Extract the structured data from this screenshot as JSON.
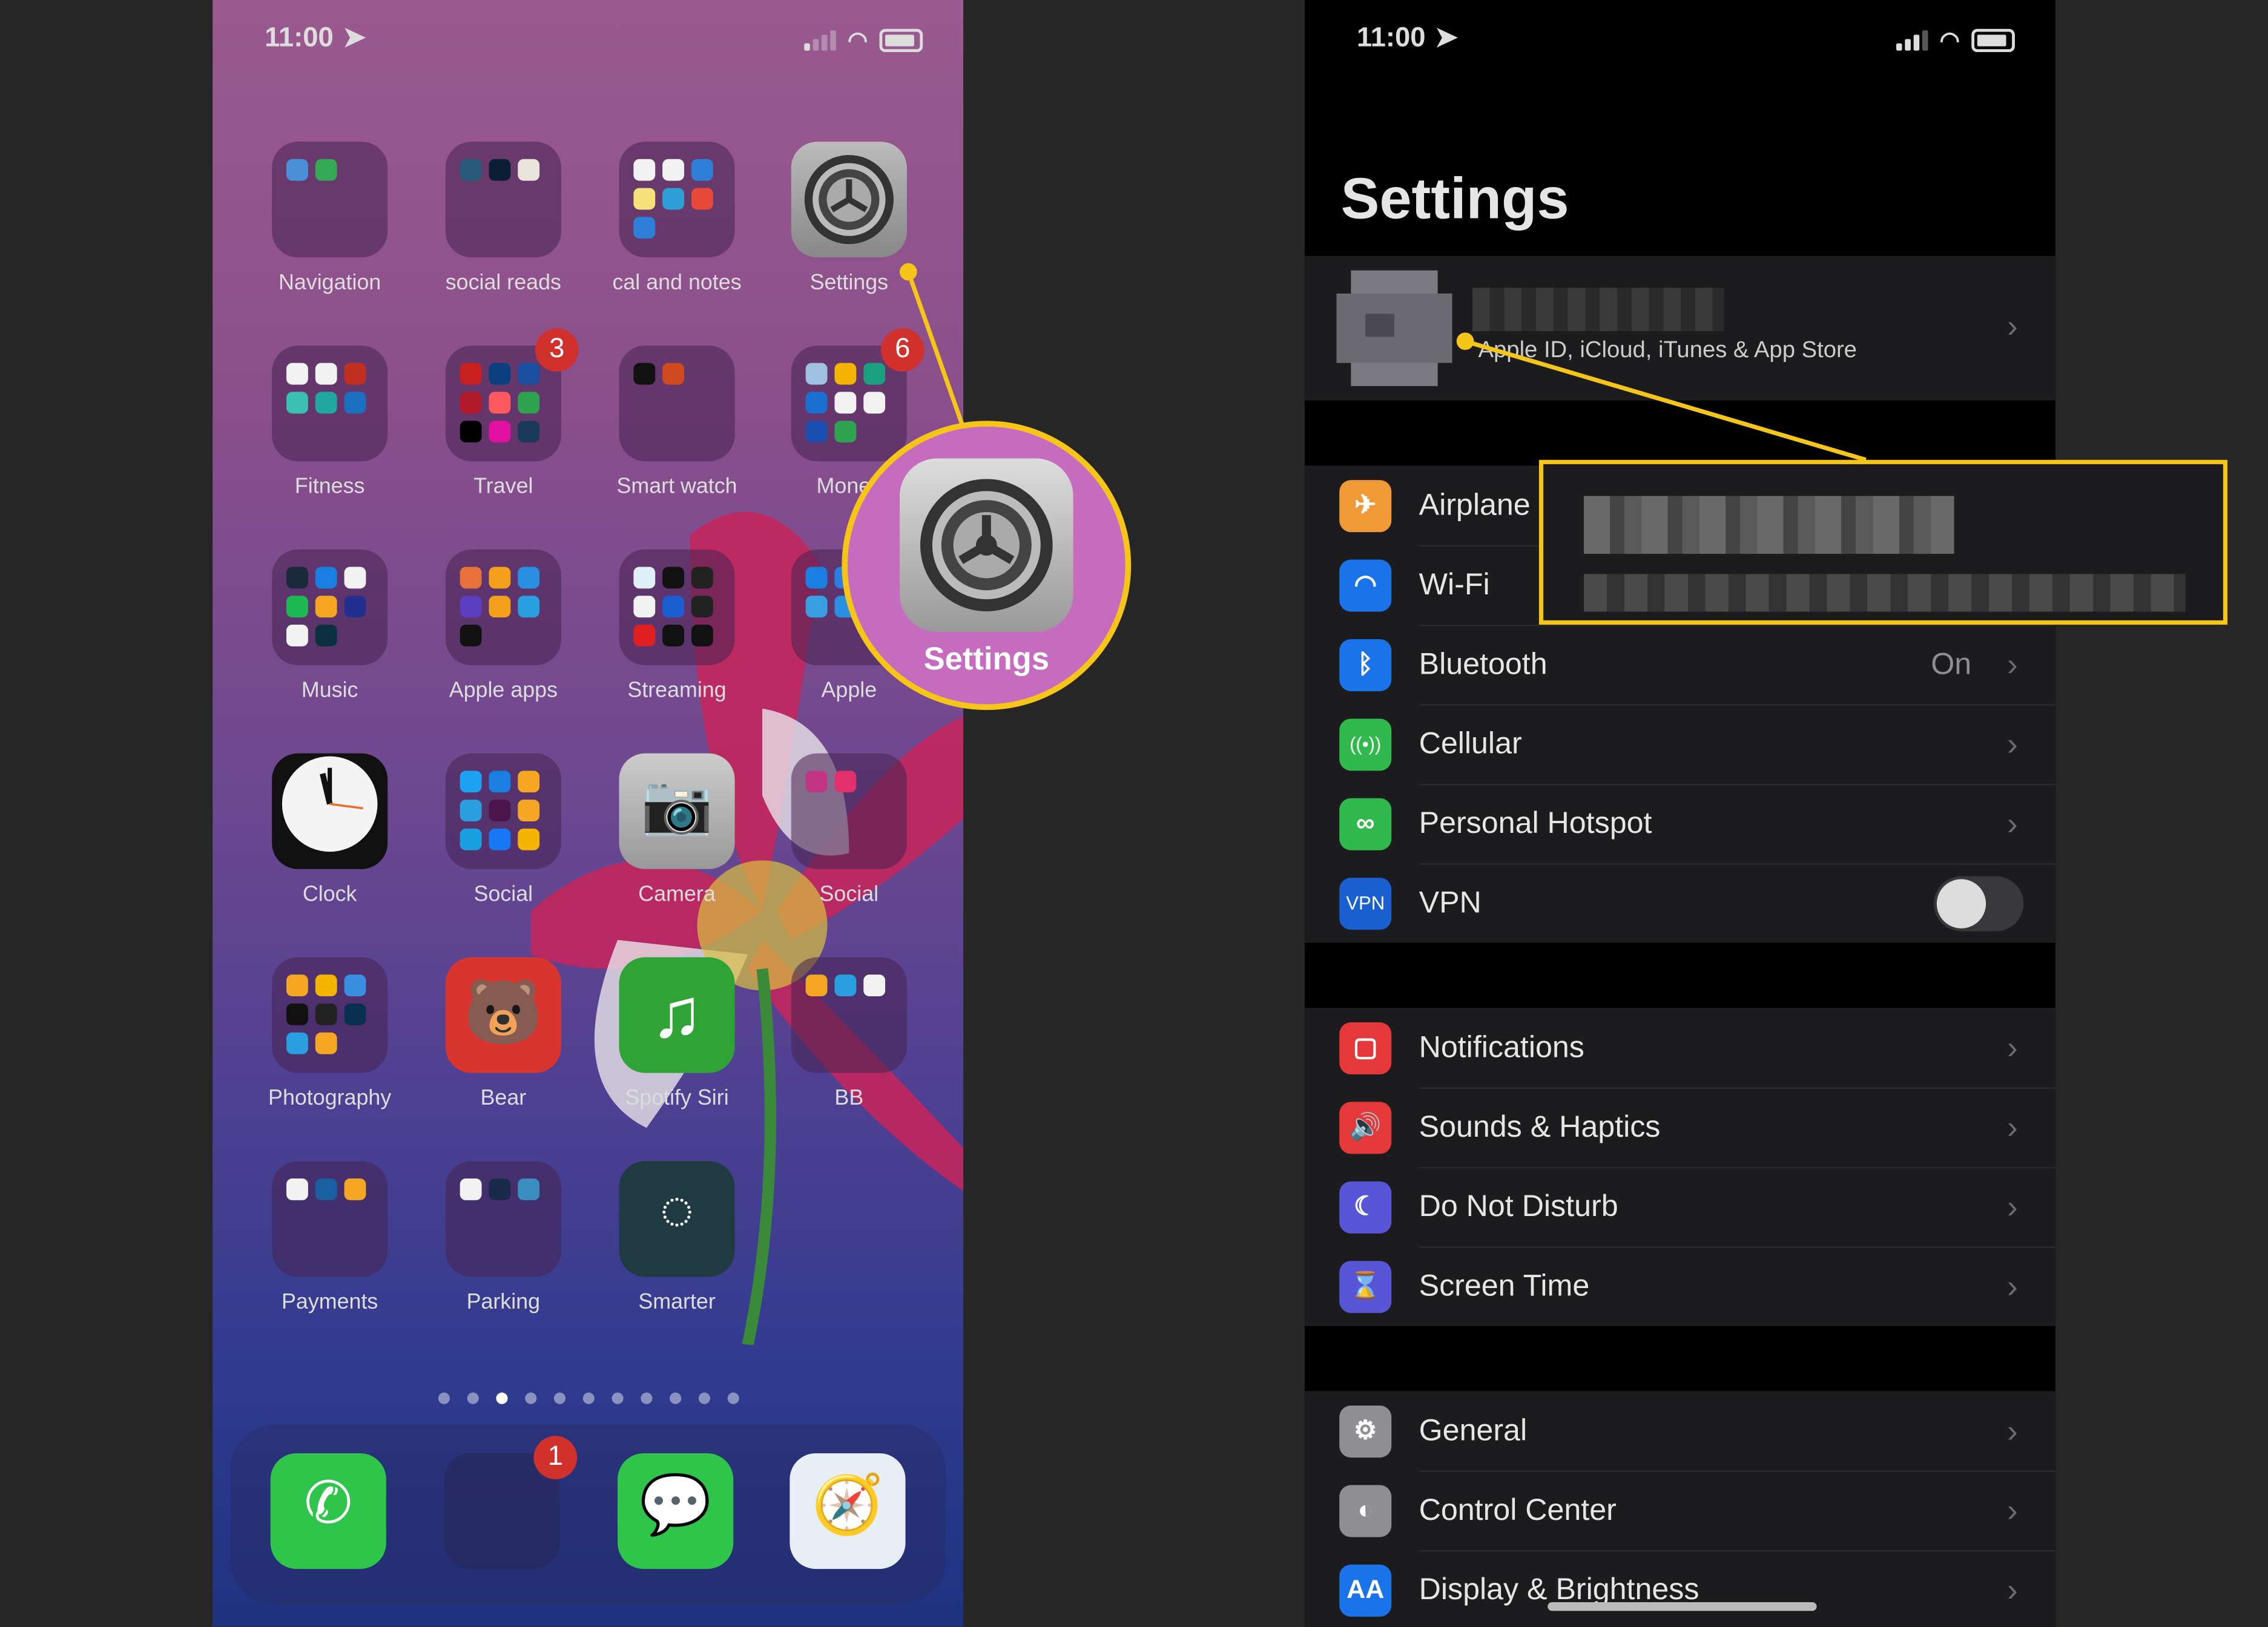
{
  "accent_color": "#f5c518",
  "home_screen": {
    "status": {
      "time": "11:00",
      "location_icon": "location-arrow-icon",
      "signal_icon": "cellular-signal-icon",
      "wifi_icon": "wifi-icon",
      "battery_icon": "battery-icon"
    },
    "apps": [
      {
        "label": "Navigation",
        "type": "folder",
        "minis": [
          "#4a90d9",
          "#34a853"
        ]
      },
      {
        "label": "social reads",
        "type": "folder",
        "minis": [
          "#2b5b7a",
          "#0b1e33",
          "#e8e4da"
        ]
      },
      {
        "label": "cal and notes",
        "type": "folder",
        "minis": [
          "#f2f2f2",
          "#f2f2f2",
          "#2f7fd8",
          "#f7e07a",
          "#2f9fd8",
          "#e84a3a",
          "#2f7fd8"
        ]
      },
      {
        "label": "Settings",
        "type": "settings"
      },
      {
        "label": "Fitness",
        "type": "folder",
        "minis": [
          "#f2f2f2",
          "#f2f2f2",
          "#c0301f",
          "#3ac0b0",
          "#20a8a0",
          "#1a6fc0"
        ]
      },
      {
        "label": "Travel",
        "type": "folder",
        "badge": "3",
        "minis": [
          "#c81f1f",
          "#0a3f80",
          "#1a4f9f",
          "#b01a2a",
          "#ff5a5f",
          "#2fa34f",
          "#000000",
          "#e010a0",
          "#1b3a5a"
        ]
      },
      {
        "label": "Smart watch",
        "type": "folder",
        "minis": [
          "#111111",
          "#d04a20"
        ]
      },
      {
        "label": "Money",
        "type": "folder",
        "badge": "6",
        "minis": [
          "#9fc0e0",
          "#f5b400",
          "#1a9f7f",
          "#1a6fd0",
          "#f2f2f2",
          "#f2f2f2",
          "#1a4fb0",
          "#2fa34f"
        ]
      },
      {
        "label": "Music",
        "type": "folder",
        "minis": [
          "#1a2a3a",
          "#1a7fe0",
          "#f2f2f2",
          "#1db954",
          "#f5a623",
          "#232f8e",
          "#f2f2f2",
          "#0a3040"
        ]
      },
      {
        "label": "Apple apps",
        "type": "folder",
        "minis": [
          "#e8703a",
          "#f59f1a",
          "#2a8fe0",
          "#5a3fc0",
          "#f5a01a",
          "#2a9fe0",
          "#111111"
        ]
      },
      {
        "label": "Streaming",
        "type": "folder",
        "minis": [
          "#e0f0f8",
          "#111111",
          "#222222",
          "#f2f2f2",
          "#1a5fd0",
          "#222222",
          "#e02020",
          "#111111",
          "#111111"
        ]
      },
      {
        "label": "Apple",
        "type": "folder",
        "minis": [
          "#1a7fe0",
          "#2a7fe0",
          "#f5b400",
          "#3a9fe0",
          "#2a8fe0",
          "#f2f2f2"
        ]
      },
      {
        "label": "Clock",
        "type": "clock"
      },
      {
        "label": "Social",
        "type": "folder",
        "minis": [
          "#1da1f2",
          "#1a7fe0",
          "#f5a623",
          "#2a9fe0",
          "#4a154b",
          "#f5a623",
          "#1a9fe0",
          "#1877f2",
          "#f5b400"
        ]
      },
      {
        "label": "Camera",
        "type": "camera"
      },
      {
        "label": "Social",
        "type": "folder",
        "minis": [
          "#c13584",
          "#e1306c"
        ]
      },
      {
        "label": "Photography",
        "type": "folder",
        "minis": [
          "#f5a623",
          "#f5b400",
          "#3a8fe0",
          "#111111",
          "#222222",
          "#0a3050",
          "#2a9fe0",
          "#f5a623"
        ]
      },
      {
        "label": "Bear",
        "type": "bear"
      },
      {
        "label": "Spotify Siri",
        "type": "music"
      },
      {
        "label": "BB",
        "type": "folder",
        "minis": [
          "#f5a623",
          "#2a9fe0",
          "#f2f2f2"
        ]
      },
      {
        "label": "Payments",
        "type": "folder",
        "minis": [
          "#f2f2f2",
          "#1a5f9f",
          "#f5a623"
        ]
      },
      {
        "label": "Parking",
        "type": "folder",
        "minis": [
          "#f2f2f2",
          "#1a2a4a",
          "#3a8fc0"
        ]
      },
      {
        "label": "Smarter",
        "type": "smarter"
      }
    ],
    "page_dots": {
      "count": 11,
      "active": 2
    },
    "dock": [
      {
        "name": "phone",
        "color": "#2fc44a",
        "glyph": "✆"
      },
      {
        "name": "mail-folder",
        "badge": "1",
        "color": "rgba(40,40,90,.6)",
        "glyph": ""
      },
      {
        "name": "messages",
        "color": "#2fc44a",
        "glyph": "💬"
      },
      {
        "name": "safari",
        "color": "#e8eef5",
        "glyph": "🧭"
      }
    ],
    "magnifier_label": "Settings"
  },
  "settings_screen": {
    "status": {
      "time": "11:00"
    },
    "title": "Settings",
    "account_subtitle": "Apple ID, iCloud, iTunes & App Store",
    "groups": [
      [
        {
          "label": "Airplane Mode",
          "visible_label": "Airplane",
          "icon": "airplane-icon",
          "glyph": "✈",
          "color": "#f09a37",
          "control": "toggle-hidden"
        },
        {
          "label": "Wi-Fi",
          "icon": "wifi-icon",
          "glyph": "◠",
          "color": "#1a73e8"
        },
        {
          "label": "Bluetooth",
          "icon": "bluetooth-icon",
          "glyph": "ᛒ",
          "color": "#1a73e8",
          "value": "On"
        },
        {
          "label": "Cellular",
          "icon": "cellular-antenna-icon",
          "glyph": "((•))",
          "color": "#30b94d"
        },
        {
          "label": "Personal Hotspot",
          "icon": "hotspot-link-icon",
          "glyph": "∞",
          "color": "#30b94d"
        },
        {
          "label": "VPN",
          "icon": "vpn-icon",
          "glyph": "VPN",
          "color": "#1a5fd0",
          "control": "toggle",
          "toggle_on": false
        }
      ],
      [
        {
          "label": "Notifications",
          "icon": "notifications-icon",
          "glyph": "▢",
          "color": "#e5383b"
        },
        {
          "label": "Sounds & Haptics",
          "icon": "speaker-icon",
          "glyph": "🔊",
          "color": "#e5383b"
        },
        {
          "label": "Do Not Disturb",
          "icon": "moon-icon",
          "glyph": "☾",
          "color": "#5856d6"
        },
        {
          "label": "Screen Time",
          "icon": "hourglass-icon",
          "glyph": "⌛",
          "color": "#5856d6"
        }
      ],
      [
        {
          "label": "General",
          "icon": "gear-icon",
          "glyph": "⚙",
          "color": "#8e8e93"
        },
        {
          "label": "Control Center",
          "icon": "toggles-icon",
          "glyph": "◐",
          "color": "#8e8e93"
        },
        {
          "label": "Display & Brightness",
          "icon": "text-size-icon",
          "glyph": "AA",
          "color": "#1a73e8"
        }
      ]
    ]
  }
}
